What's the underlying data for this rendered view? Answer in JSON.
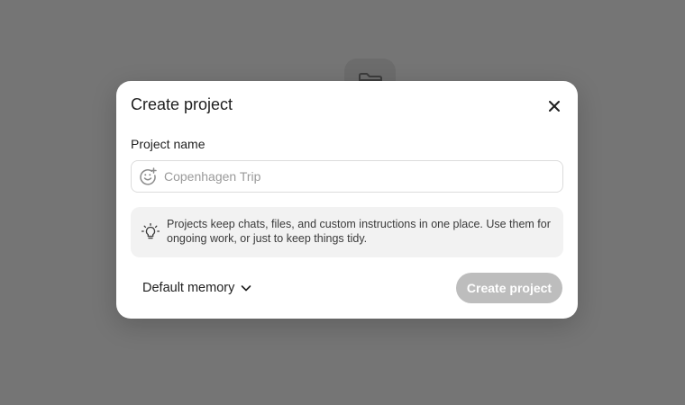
{
  "dialog": {
    "title": "Create project",
    "close_icon": "close-icon",
    "name_label": "Project name",
    "name_input": {
      "value": "",
      "placeholder": "Copenhagen Trip",
      "icon": "emoji-add-icon"
    },
    "info": {
      "icon": "lightbulb-icon",
      "text": "Projects keep chats, files, and custom instructions in one place. Use them for ongoing work, or just to keep things tidy."
    },
    "memory_dropdown": {
      "selected": "Default memory",
      "icon": "chevron-down-icon"
    },
    "create_button": {
      "label": "Create project",
      "state": "disabled"
    }
  },
  "background": {
    "icon": "folder-icon"
  },
  "colors": {
    "overlay": "#757575",
    "modal_bg": "#ffffff",
    "info_bg": "#f2f2f2",
    "button_disabled": "#bdbdbd",
    "text_primary": "#1f1f1f",
    "placeholder": "#9a9a9a"
  }
}
